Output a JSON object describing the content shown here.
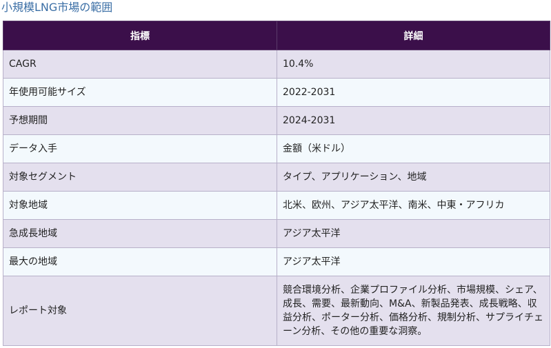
{
  "page_title": "小規模LNG市場の範囲",
  "table": {
    "headers": [
      "指標",
      "詳細"
    ],
    "rows": [
      {
        "metric": "CAGR",
        "detail": "10.4%"
      },
      {
        "metric": "年使用可能サイズ",
        "detail": "2022-2031"
      },
      {
        "metric": "予想期間",
        "detail": "2024-2031"
      },
      {
        "metric": "データ入手",
        "detail": "金額（米ドル）"
      },
      {
        "metric": "対象セグメント",
        "detail": "タイプ、アプリケーション、地域"
      },
      {
        "metric": "対象地域",
        "detail": "北米、欧州、アジア太平洋、南米、中東・アフリカ"
      },
      {
        "metric": "急成長地域",
        "detail": "アジア太平洋"
      },
      {
        "metric": "最大の地域",
        "detail": "アジア太平洋"
      },
      {
        "metric": "レポート対象",
        "detail": "競合環境分析、企業プロファイル分析、市場規模、シェア、成長、需要、最新動向、M&A、新製品発表、成長戦略、収益分析、ポーター分析、価格分析、規制分析、サプライチェーン分析、その他の重要な洞察。"
      }
    ]
  },
  "colors": {
    "title": "#3a6ea5",
    "header_bg": "#3b0f4a",
    "row_odd_bg": "#e4e0ee",
    "row_even_bg": "#f3f9fd"
  }
}
